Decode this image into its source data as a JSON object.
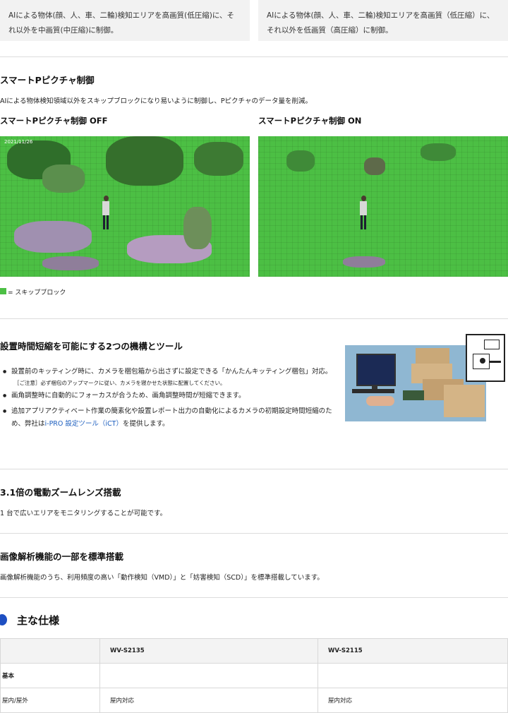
{
  "top_boxes": [
    "AIによる物体(顔、人、車、二輪)検知エリアを高画質(低圧縮)に、それ以外を中画質(中圧縮)に制御。",
    "AIによる物体(顔、人、車、二輪)検知エリアを高画質（低圧縮）に、それ以外を低画質（高圧縮）に制御。"
  ],
  "smart_p": {
    "title": "スマートPピクチャ制御",
    "desc": "AIによる物体検知領域以外をスキップブロックになり易いように制御し、Pピクチャのデータ量を削減。",
    "off_label": "スマートPピクチャ制御 OFF",
    "on_label": "スマートPピクチャ制御 ON",
    "timestamp": "2021/11/26",
    "legend": "= スキップブロック",
    "skip_color": "#4cbf44"
  },
  "install": {
    "title": "設置時間短縮を可能にする2つの機構とツール",
    "bullet1": "設置前のキッティング時に、カメラを梱包箱から出さずに設定できる「かんたんキッティング梱包」対応。",
    "note1": "［ご注意］必ず梱包のアップマークに従い、カメラを寝かせた状態に配置してください。",
    "bullet2": "画角調整時に自動的にフォーカスが合うため、画角調整時間が短縮できます。",
    "bullet3_a": "追加アプリアクティベート作業の簡素化や設置レポート出力の自動化によるカメラの初期設定時間短縮のため、弊社は",
    "bullet3_link": "i-PRO 設定ツール（iCT）",
    "bullet3_b": "を提供します。"
  },
  "zoom": {
    "title": "3.1倍の電動ズームレンズ搭載",
    "desc": "1 台で広いエリアをモニタリングすることが可能です。"
  },
  "analytics": {
    "title": "画像解析機能の一部を標準搭載",
    "desc": "画像解析機能のうち、利用頻度の高い「動作検知（VMD）」と「妨害検知（SCD）」を標準搭載しています。"
  },
  "specs": {
    "title": "主な仕様",
    "col1": "WV-S2135",
    "col2": "WV-S2115",
    "group": "基本",
    "row_label": "屋内/屋外",
    "row_v1": "屋内対応",
    "row_v2": "屋内対応",
    "accent": "#1e4fc2"
  }
}
